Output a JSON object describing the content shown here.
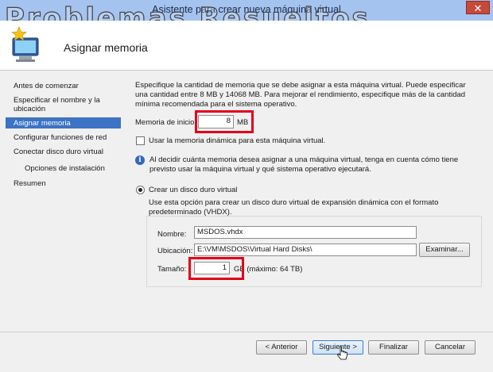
{
  "window": {
    "title": "Asistente para crear nueva máquina virtual",
    "close_glyph": "✕",
    "watermark": "Problemas Resueltos"
  },
  "header": {
    "title": "Asignar memoria",
    "icon": "computer-star-icon"
  },
  "nav": {
    "items": [
      "Antes de comenzar",
      "Especificar el nombre y la ubicación",
      "Asignar memoria",
      "Configurar funciones de red",
      "Conectar disco duro virtual",
      "Opciones de instalación",
      "Resumen"
    ],
    "selected_index": 2
  },
  "content": {
    "description": "Especifique la cantidad de memoria que se debe asignar a esta máquina virtual. Puede especificar una cantidad entre 8 MB y 14068 MB. Para mejorar el rendimiento, especifique más de la cantidad mínima recomendada para el sistema operativo.",
    "startup_memory_label": "Memoria de inicio:",
    "startup_memory_value": "8",
    "startup_memory_unit": "MB",
    "dynamic_memory_label": "Usar la memoria dinámica para esta máquina virtual.",
    "dynamic_memory_checked": false,
    "info_text": "Al decidir cuánta memoria desea asignar a una máquina virtual, tenga en cuenta cómo tiene previsto usar la máquina virtual y qué sistema operativo ejecutará.",
    "create_disk_label": "Crear un disco duro virtual",
    "create_disk_selected": true,
    "create_disk_desc": "Use esta opción para crear un disco duro virtual de expansión dinámica con el formato predeterminado (VHDX).",
    "name_label": "Nombre:",
    "name_value": "MSDOS.vhdx",
    "location_label": "Ubicación:",
    "location_value": "E:\\VM\\MSDOS\\Virtual Hard Disks\\",
    "browse_label": "Examinar...",
    "size_label": "Tamaño:",
    "size_value": "1",
    "size_unit": "GB (máximo: 64 TB)"
  },
  "footer": {
    "previous": "< Anterior",
    "next": "Siguiente >",
    "finish": "Finalizar",
    "cancel": "Cancelar"
  },
  "colors": {
    "titlebar": "#a5c3ef",
    "selection": "#3c73c4",
    "highlight": "#e3001b"
  }
}
